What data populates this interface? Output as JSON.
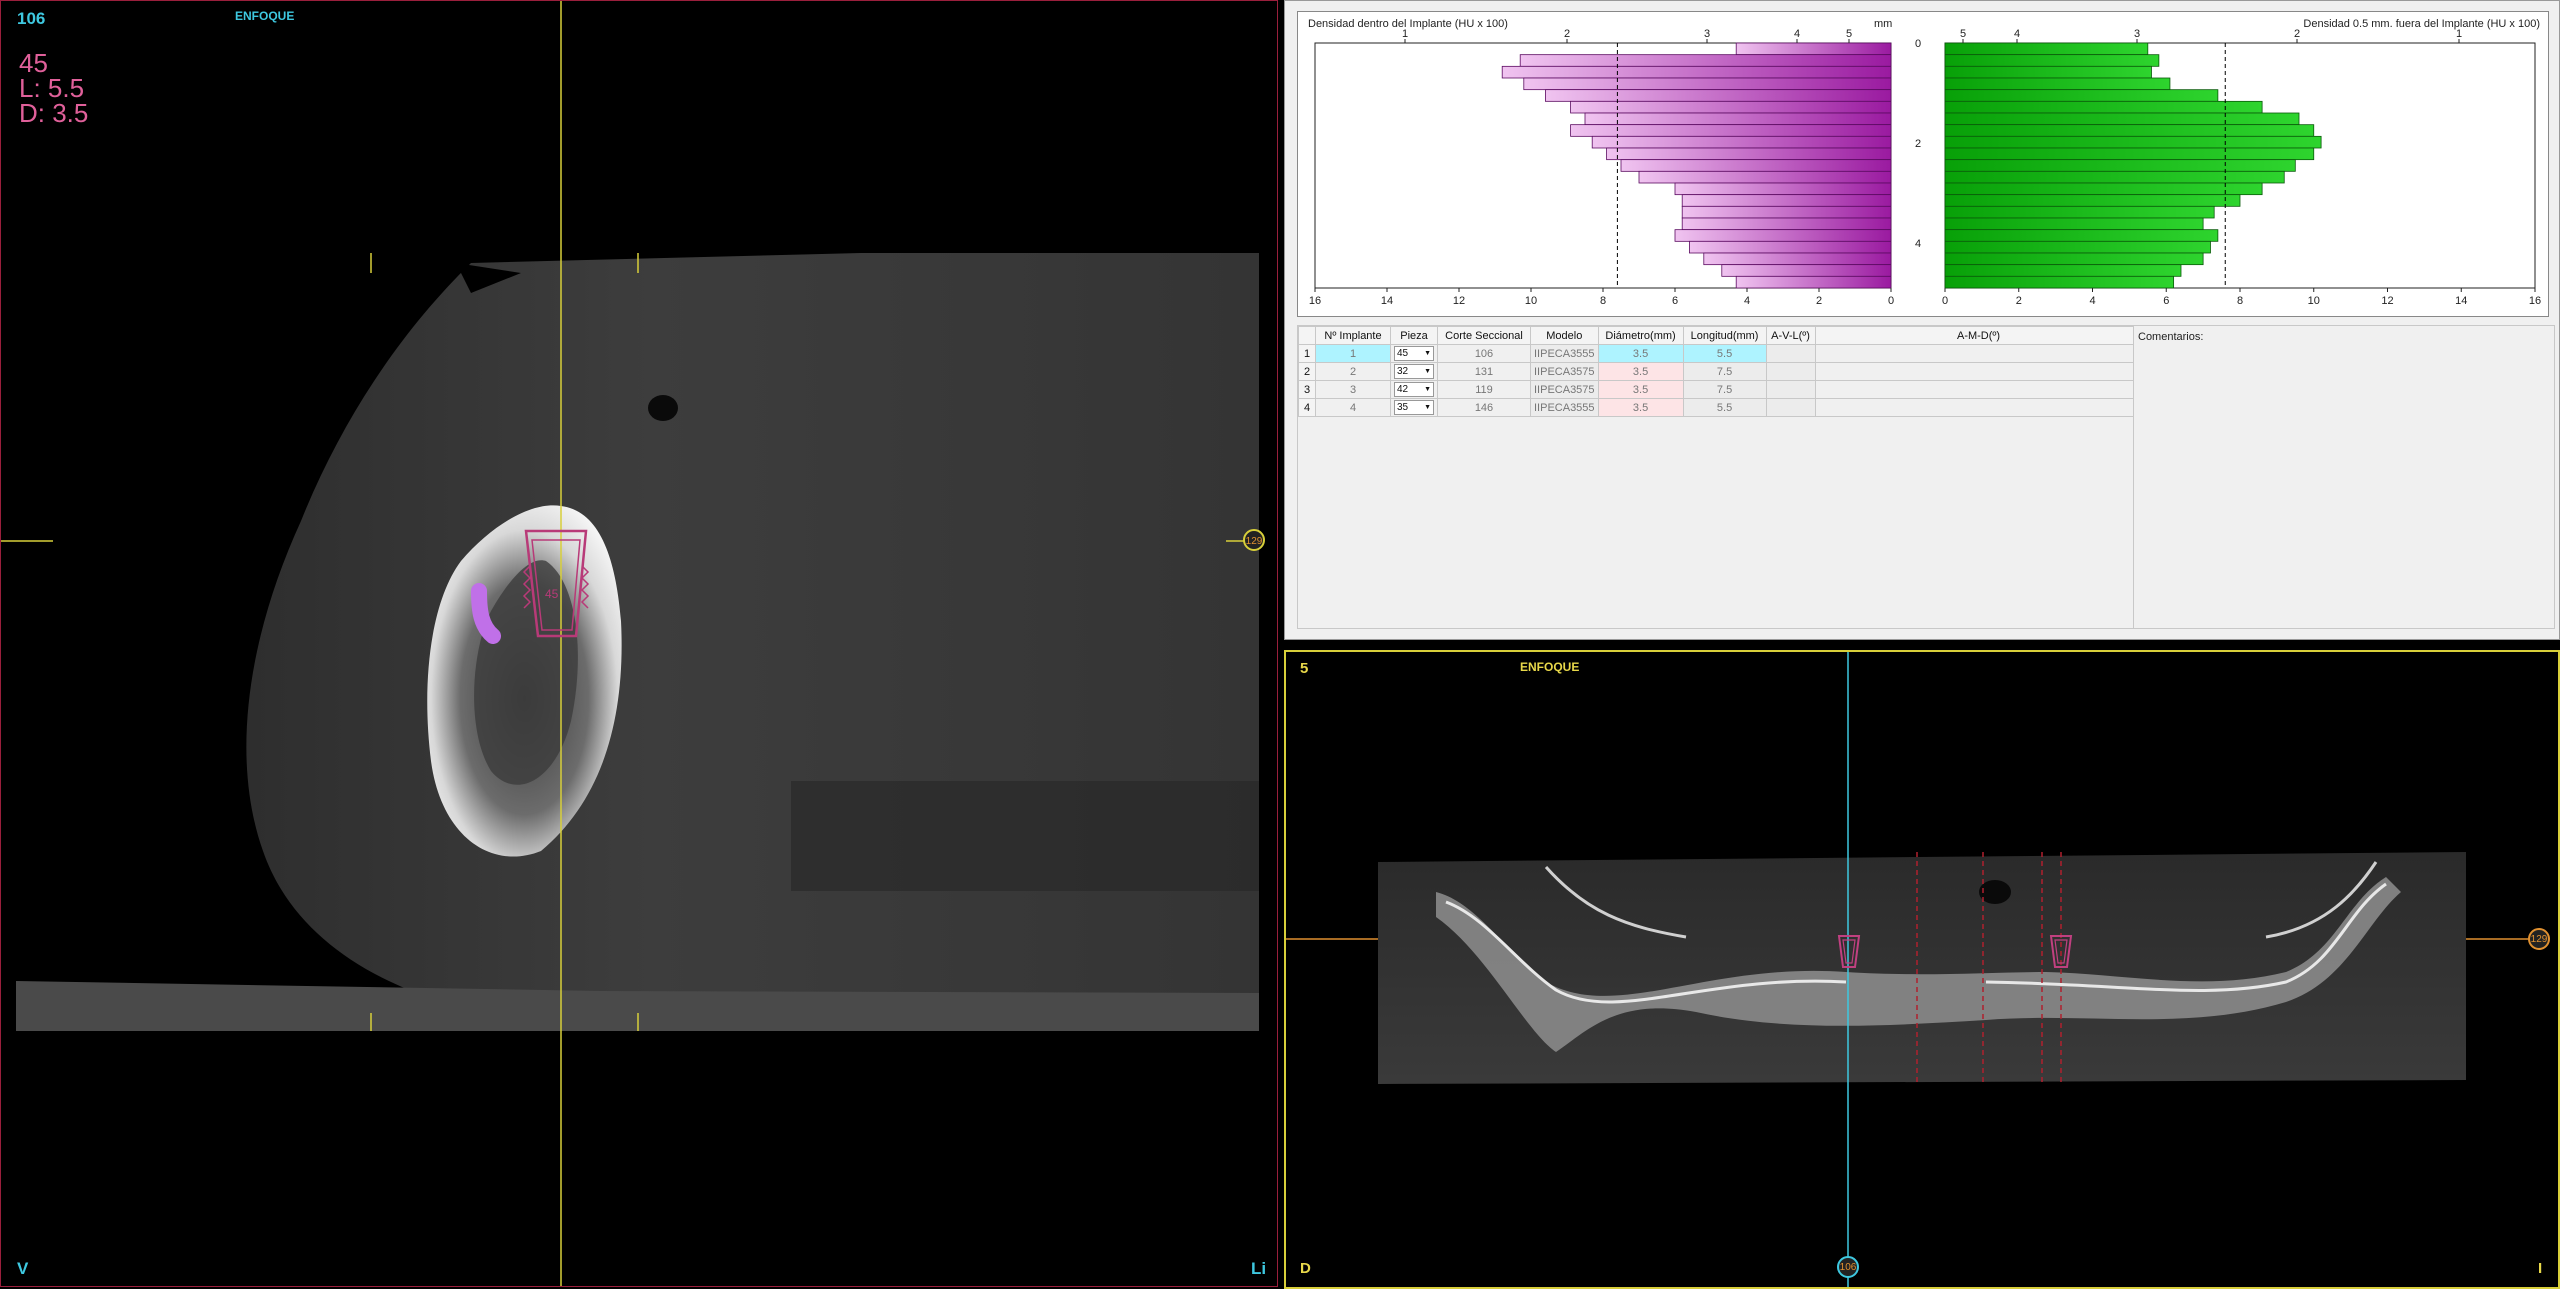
{
  "left_viewport": {
    "slice_number": "106",
    "view_label": "ENFOQUE",
    "implant": {
      "tooth": "45",
      "length": "L: 5.5",
      "diameter": "D: 3.5"
    },
    "implant_marker_label": "45",
    "orientation_left": "V",
    "orientation_right": "Li",
    "slider_badge": "129",
    "colors": {
      "border": "#9a1f3c",
      "crosshair": "#d8cf3a",
      "implant": "#b83a78"
    }
  },
  "density_chart": {
    "left_title": "Densidad dentro del Implante (HU x 100)",
    "right_title": "Densidad 0.5 mm. fuera del Implante (HU x 100)",
    "mm_label": "mm",
    "left_top_ticks": [
      "1",
      "2",
      "3",
      "4",
      "5"
    ],
    "right_top_ticks": [
      "5",
      "4",
      "3",
      "2",
      "1"
    ],
    "mm_ticks": [
      "0",
      "2",
      "4"
    ],
    "left_bottom_ticks": [
      "16",
      "14",
      "12",
      "10",
      "8",
      "6",
      "4",
      "2",
      "0"
    ],
    "right_bottom_ticks": [
      "0",
      "2",
      "4",
      "6",
      "8",
      "10",
      "12",
      "14",
      "16"
    ],
    "colors": {
      "inside": "#a020a8",
      "outside": "#0cab0c"
    }
  },
  "chart_data": {
    "type": "bar",
    "orientation": "horizontal",
    "y_axis": "depth (mm)",
    "ylim": [
      0,
      5
    ],
    "xlim": [
      0,
      16
    ],
    "series": [
      {
        "name": "Densidad dentro del Implante (HU x 100)",
        "values": [
          4.3,
          10.3,
          10.8,
          10.2,
          9.6,
          8.9,
          8.5,
          8.9,
          8.3,
          7.9,
          7.5,
          7.0,
          6.0,
          5.8,
          5.8,
          5.8,
          6.0,
          5.6,
          5.2,
          4.7,
          4.3
        ]
      },
      {
        "name": "Densidad 0.5 mm. fuera del Implante (HU x 100)",
        "values": [
          5.5,
          5.8,
          5.6,
          6.1,
          7.4,
          8.6,
          9.6,
          10.0,
          10.2,
          10.0,
          9.5,
          9.2,
          8.6,
          8.0,
          7.3,
          7.0,
          7.4,
          7.2,
          7.0,
          6.4,
          6.2
        ]
      }
    ],
    "reference_line": 7.6
  },
  "implant_table": {
    "headers": [
      "Nº Implante",
      "Pieza",
      "Corte Seccional",
      "Modelo",
      "Diámetro(mm)",
      "Longitud(mm)",
      "A-V-L(º)",
      "A-M-D(º)"
    ],
    "rows": [
      {
        "row": "1",
        "num": "1",
        "pieza": "45",
        "corte": "106",
        "modelo": "IIPECA3555",
        "diametro": "3.5",
        "longitud": "5.5"
      },
      {
        "row": "2",
        "num": "2",
        "pieza": "32",
        "corte": "131",
        "modelo": "IIPECA3575",
        "diametro": "3.5",
        "longitud": "7.5"
      },
      {
        "row": "3",
        "num": "3",
        "pieza": "42",
        "corte": "119",
        "modelo": "IIPECA3575",
        "diametro": "3.5",
        "longitud": "7.5"
      },
      {
        "row": "4",
        "num": "4",
        "pieza": "35",
        "corte": "146",
        "modelo": "IIPECA3555",
        "diametro": "3.5",
        "longitud": "5.5"
      }
    ],
    "comments_label": "Comentarios:"
  },
  "bottom_viewport": {
    "slice_number": "5",
    "view_label": "ENFOQUE",
    "orientation_left": "D",
    "orientation_right": "I",
    "bottom_badge": "106",
    "right_badge": "129",
    "colors": {
      "border": "#d8cf3a",
      "crosshair": "#3ec8e0",
      "cut_lines": "#b0202e"
    }
  }
}
